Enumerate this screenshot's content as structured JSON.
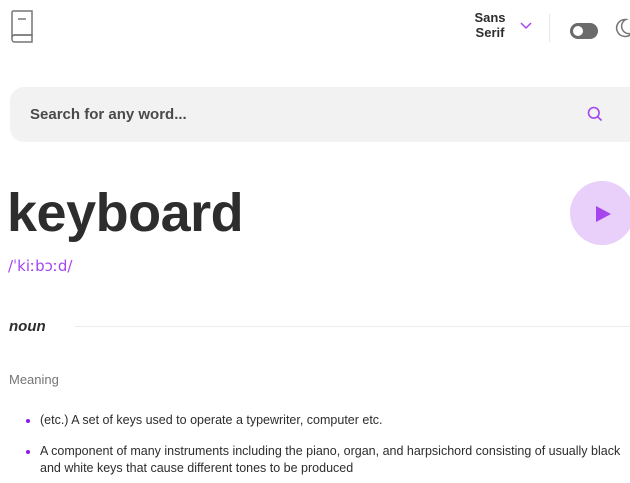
{
  "header": {
    "logo_icon": "book-icon",
    "font_select": {
      "label_line1": "Sans",
      "label_line2": "Serif",
      "icon": "chevron-down-icon"
    },
    "theme_toggle": {
      "state": "off",
      "icon": "toggle-icon"
    },
    "theme_icon": "moon-icon"
  },
  "search": {
    "placeholder": "Search for any word...",
    "value": "",
    "icon": "search-icon"
  },
  "entry": {
    "word": "keyboard",
    "phonetic": "/ˈkiːbɔːd/",
    "play_icon": "play-icon",
    "part_of_speech": "noun",
    "meaning_heading": "Meaning",
    "definitions": [
      "(etc.) A set of keys used to operate a typewriter, computer etc.",
      "A component of many instruments including the piano, organ, and harpsichord consisting of usually black and white keys that cause different tones to be produced"
    ]
  },
  "colors": {
    "accent": "#A445ED",
    "accent_light": "#E9D0FA",
    "text": "#2D2D2D",
    "muted": "#757575",
    "search_bg": "#F2F2F2"
  }
}
